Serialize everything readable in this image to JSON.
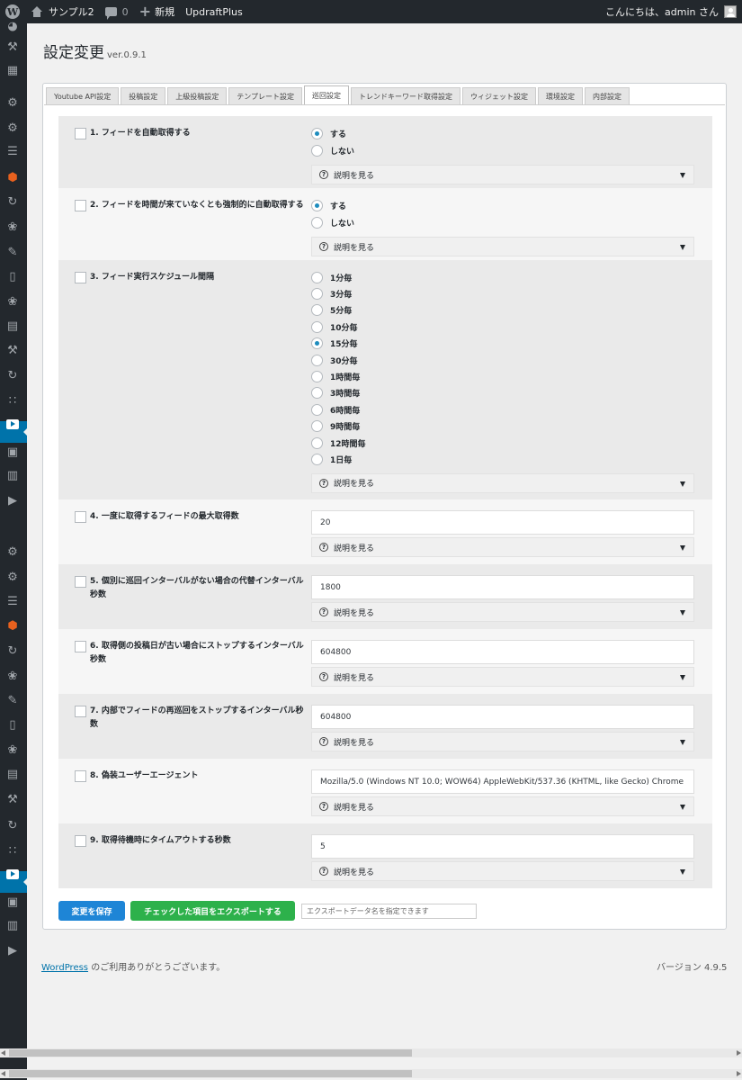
{
  "adminbar": {
    "site_name": "サンプル2",
    "comments_count": "0",
    "new_label": "新規",
    "plugin_label": "UpdraftPlus",
    "greeting": "こんにちは、admin さん"
  },
  "page": {
    "title": "設定変更",
    "version": "ver.0.9.1"
  },
  "tabs": [
    "Youtube API設定",
    "投稿設定",
    "上級投稿設定",
    "テンプレート設定",
    "巡回設定",
    "トレンドキーワード取得設定",
    "ウィジェット設定",
    "環境設定",
    "内部設定"
  ],
  "active_tab": "巡回設定",
  "details_label": "説明を見る",
  "settings": [
    {
      "label": "1. フィードを自動取得する",
      "options": [
        "する",
        "しない"
      ],
      "selected": "する"
    },
    {
      "label": "2. フィードを時間が来ていなくとも強制的に自動取得する",
      "options": [
        "する",
        "しない"
      ],
      "selected": "する"
    },
    {
      "label": "3. フィード実行スケジュール間隔",
      "options": [
        "1分毎",
        "3分毎",
        "5分毎",
        "10分毎",
        "15分毎",
        "30分毎",
        "1時間毎",
        "3時間毎",
        "6時間毎",
        "9時間毎",
        "12時間毎",
        "1日毎"
      ],
      "selected": "15分毎"
    },
    {
      "label": "4. 一度に取得するフィードの最大取得数",
      "value": "20"
    },
    {
      "label": "5. 個別に巡回インターバルがない場合の代替インターバル秒数",
      "value": "1800"
    },
    {
      "label": "6. 取得側の投稿日が古い場合にストップするインターバル秒数",
      "value": "604800"
    },
    {
      "label": "7. 内部でフィードの再巡回をストップするインターバル秒数",
      "value": "604800"
    },
    {
      "label": "8. 偽装ユーザーエージェント",
      "value": "Mozilla/5.0 (Windows NT 10.0; WOW64) AppleWebKit/537.36 (KHTML, like Gecko) Chrome"
    },
    {
      "label": "9. 取得待機時にタイムアウトする秒数",
      "value": "5"
    }
  ],
  "buttons": {
    "save": "変更を保存",
    "export": "チェックした項目をエクスポートする"
  },
  "export_name_placeholder": "エクスポートデータ名を指定できます",
  "footer": {
    "link": "WordPress",
    "text": " のご利用ありがとうございます。",
    "version": "バージョン 4.9.5"
  },
  "sidebar_icons": [
    "dashboard",
    "wrench",
    "table",
    "gear",
    "gear",
    "list",
    "cube",
    "refresh",
    "twitter",
    "edit",
    "phone",
    "twitter",
    "grid",
    "wrench",
    "refresh",
    "rss",
    "youtube",
    "calendar",
    "book",
    "play",
    "gear",
    "gear",
    "list",
    "cube",
    "refresh",
    "twitter",
    "edit",
    "phone",
    "twitter",
    "grid",
    "wrench",
    "refresh",
    "rss",
    "youtube",
    "calendar",
    "book",
    "play"
  ]
}
